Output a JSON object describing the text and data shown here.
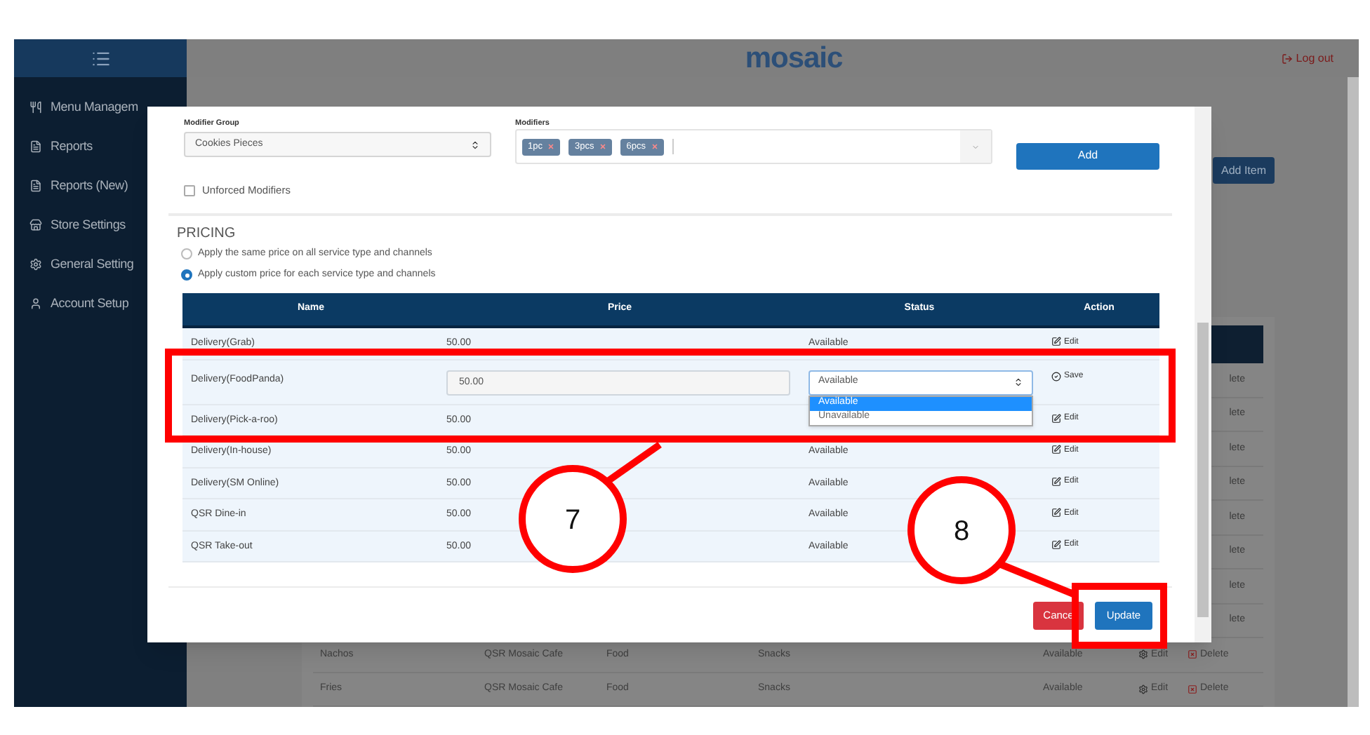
{
  "header": {
    "logo": "mosaic",
    "logout": "Log out"
  },
  "sidebar": {
    "items": [
      {
        "label": "Menu Managem"
      },
      {
        "label": "Reports"
      },
      {
        "label": "Reports (New)"
      },
      {
        "label": "Store Settings"
      },
      {
        "label": "General Setting"
      },
      {
        "label": "Account Setup"
      }
    ]
  },
  "background": {
    "add_button": "Add Item",
    "rows": [
      {
        "kind": "partial",
        "delete": "lete"
      },
      {
        "kind": "partial",
        "delete": "lete"
      },
      {
        "kind": "partial",
        "delete": "lete"
      },
      {
        "kind": "partial",
        "delete": "lete"
      },
      {
        "kind": "partial",
        "delete": "lete"
      },
      {
        "kind": "partial",
        "delete": "lete"
      },
      {
        "kind": "partial",
        "delete": "lete"
      },
      {
        "kind": "partial",
        "delete": "lete"
      },
      {
        "kind": "full",
        "column_1": "Nachos",
        "column_2": "QSR Mosaic Cafe",
        "column_3": "Food",
        "column_4": "Snacks",
        "column_5": "Available",
        "edit": "Edit",
        "delete": "Delete"
      },
      {
        "kind": "full",
        "column_1": "Fries",
        "column_2": "QSR Mosaic Cafe",
        "column_3": "Food",
        "column_4": "Snacks",
        "column_5": "Available",
        "edit": "Edit",
        "delete": "Delete"
      }
    ]
  },
  "modal": {
    "modifier_group": {
      "label": "Modifier Group",
      "value": "Cookies Pieces"
    },
    "modifiers": {
      "label": "Modifiers",
      "tags": [
        "1pc",
        "3pcs",
        "6pcs"
      ]
    },
    "add_button": "Add",
    "unforced": {
      "label": "Unforced Modifiers",
      "checked": false
    },
    "pricing_title": "PRICING",
    "pricing_options": [
      {
        "label": "Apply the same price on all service type and channels",
        "selected": false
      },
      {
        "label": "Apply custom price for each service type and channels",
        "selected": true
      }
    ],
    "table": {
      "columns": [
        "Name",
        "Price",
        "Status",
        "Action"
      ],
      "rows": [
        {
          "name": "Delivery(Grab)",
          "price": "50.00",
          "status": "Available",
          "action": "Edit",
          "editing": false
        },
        {
          "name": "Delivery(FoodPanda)",
          "price": "50.00",
          "status": "Available",
          "action": "Save",
          "editing": true,
          "expanded": true,
          "options": [
            {
              "label": "Available",
              "selected": true
            },
            {
              "label": "Unavailable",
              "selected": false
            }
          ]
        },
        {
          "name": "Delivery(Pick-a-roo)",
          "price": "50.00",
          "action": "Edit",
          "editing": false
        },
        {
          "name": "Delivery(In-house)",
          "price": "50.00",
          "status": "Available",
          "action": "Edit",
          "editing": false
        },
        {
          "name": "Delivery(SM Online)",
          "price": "50.00",
          "status": "Available",
          "action": "Edit",
          "editing": false
        },
        {
          "name": "QSR Dine-in",
          "price": "50.00",
          "status": "Available",
          "action": "Edit",
          "editing": false
        },
        {
          "name": "QSR Take-out",
          "price": "50.00",
          "status": "Available",
          "action": "Edit",
          "editing": false
        }
      ]
    },
    "cancel_button": "Cance",
    "update_button": "Update"
  },
  "annotations": [
    {
      "label": "7"
    },
    {
      "label": "8"
    }
  ]
}
